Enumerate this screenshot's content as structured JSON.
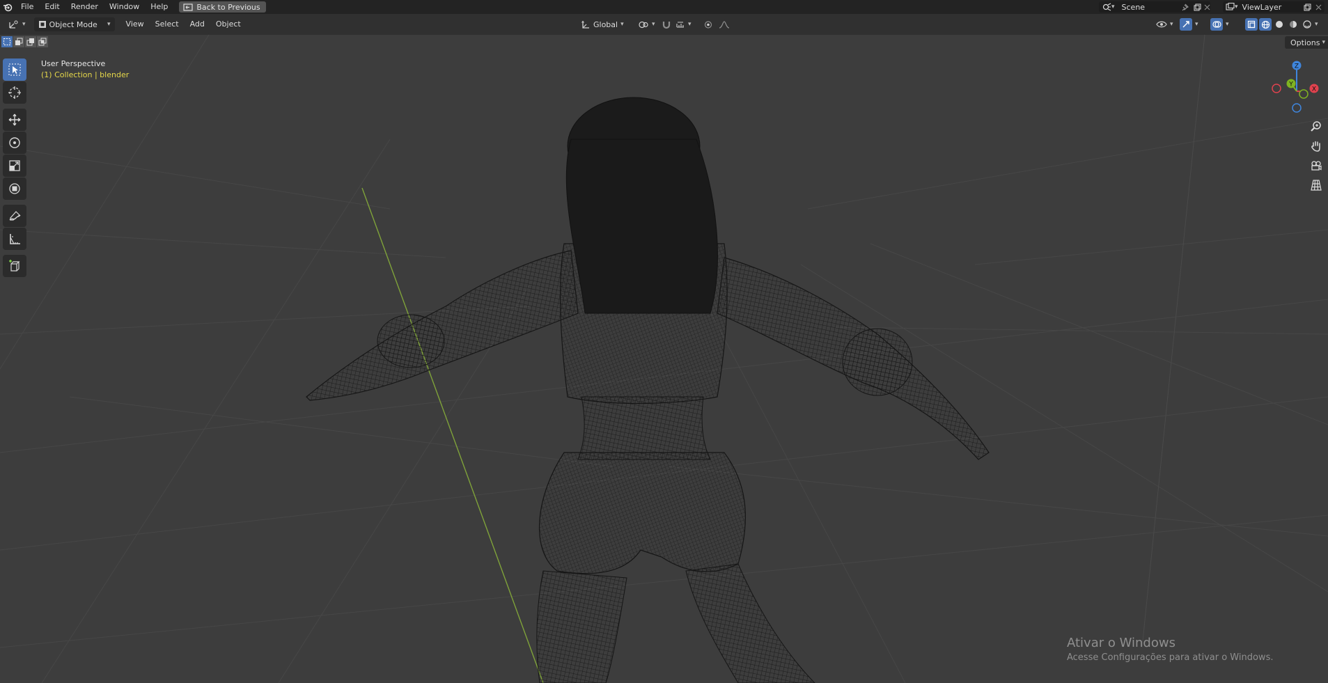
{
  "topbar": {
    "menus": [
      "File",
      "Edit",
      "Render",
      "Window",
      "Help"
    ],
    "back_button": "Back to Previous",
    "scene": "Scene",
    "view_layer": "ViewLayer"
  },
  "header": {
    "mode": "Object Mode",
    "menus": [
      "View",
      "Select",
      "Add",
      "Object"
    ],
    "orientation": "Global"
  },
  "viewport": {
    "view_name": "User Perspective",
    "collection": "(1) Collection | blender",
    "options_label": "Options",
    "gizmo": {
      "z": "Z",
      "y": "Y",
      "x": "X"
    }
  },
  "watermark": {
    "title": "Ativar o Windows",
    "subtitle": "Acesse Configurações para ativar o Windows."
  },
  "colors": {
    "active_blue": "#4772b3",
    "collection_yellow": "#e6d84a",
    "axis_x": "#e0424e",
    "axis_y": "#7fb321",
    "axis_z": "#3f86dd"
  },
  "icons": [
    "blender-logo-icon",
    "select-box-icon",
    "cursor-icon",
    "move-icon",
    "rotate-icon",
    "scale-icon",
    "transform-icon",
    "annotate-icon",
    "measure-icon",
    "add-cube-icon",
    "zoom-icon",
    "hand-pan-icon",
    "camera-icon",
    "grid-icon"
  ]
}
